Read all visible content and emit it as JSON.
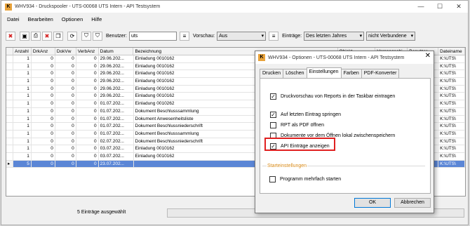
{
  "window": {
    "title": "WHV934 - Druckspooler - UTS-00068 UTS Intern - API Testsystem",
    "logo": "K"
  },
  "menu": [
    "Datei",
    "Bearbeiten",
    "Optionen",
    "Hilfe"
  ],
  "toolbar": {
    "benutzer_label": "Benutzer:",
    "benutzer_value": "uts",
    "vorschau_label": "Vorschau:",
    "vorschau_value": "Aus",
    "eintraege_label": "Einträge:",
    "eintraege_value": "Des letzten Jahres",
    "verbunden_value": "nicht Verbundene"
  },
  "grid": {
    "columns": [
      "Anzahl",
      "DrkAnz",
      "DokVw",
      "VerbAnz",
      "Datum",
      "Bezeichnung",
      "Objekt",
      "Vorgangsobj.",
      "Benutzer",
      "Dateiname"
    ],
    "rows": [
      [
        "1",
        "0",
        "0",
        "0",
        "29.06.202...",
        "Einladung 0010162",
        "",
        "",
        "",
        "K:\\UTS\\"
      ],
      [
        "1",
        "0",
        "0",
        "0",
        "29.06.202...",
        "Einladung 0010162",
        "",
        "",
        "",
        "K:\\UTS\\"
      ],
      [
        "1",
        "0",
        "0",
        "0",
        "29.06.202...",
        "Einladung 0010162",
        "",
        "",
        "",
        "K:\\UTS\\"
      ],
      [
        "1",
        "0",
        "0",
        "0",
        "29.06.202...",
        "Einladung 0010162",
        "",
        "",
        "",
        "K:\\UTS\\"
      ],
      [
        "1",
        "0",
        "0",
        "0",
        "29.06.202...",
        "Einladung 0010162",
        "",
        "",
        "",
        "K:\\UTS\\"
      ],
      [
        "1",
        "0",
        "0",
        "0",
        "29.06.202...",
        "Einladung 0010162",
        "",
        "",
        "",
        "K:\\UTS\\"
      ],
      [
        "1",
        "0",
        "0",
        "0",
        "01.07.202...",
        "Einladung 0010262",
        "",
        "",
        "",
        "K:\\UTS\\"
      ],
      [
        "1",
        "0",
        "0",
        "0",
        "01.07.202...",
        "Dokument Beschlusssammlung",
        "",
        "",
        "",
        "K:\\UTS\\"
      ],
      [
        "1",
        "0",
        "0",
        "0",
        "01.07.202...",
        "Dokument Anwesenheitsliste",
        "",
        "",
        "",
        "K:\\UTS\\"
      ],
      [
        "1",
        "0",
        "0",
        "0",
        "01.07.202...",
        "Dokument Beschlussniederschrift",
        "",
        "",
        "",
        "K:\\UTS\\"
      ],
      [
        "1",
        "0",
        "0",
        "0",
        "01.07.202...",
        "Dokument Beschlusssammlung",
        "",
        "",
        "",
        "K:\\UTS\\"
      ],
      [
        "1",
        "0",
        "0",
        "0",
        "02.07.202...",
        "Dokument Beschlussniederschrift",
        "",
        "",
        "",
        "K:\\UTS\\"
      ],
      [
        "1",
        "0",
        "0",
        "0",
        "03.07.202...",
        "Einladung 0010162",
        "",
        "",
        "",
        "K:\\UTS\\"
      ],
      [
        "1",
        "0",
        "0",
        "0",
        "03.07.202...",
        "Einladung 0010162",
        "",
        "",
        "",
        "K:\\UTS\\"
      ],
      [
        "5",
        "0",
        "0",
        "0",
        "23.07.202...",
        "",
        "",
        "",
        "",
        "K:\\UTS\\"
      ]
    ]
  },
  "status": {
    "text": "5 Einträge ausgewählt"
  },
  "dialog": {
    "title": "WHV934 - Optionen - UTS-00068 UTS Intern - API Testsystem",
    "tabs": [
      "Drucken",
      "Löschen",
      "Einstellungen",
      "Farben",
      "PDF-Konverter"
    ],
    "active_tab": "Einstellungen",
    "options": [
      {
        "label": "Druckvorschau von Reports in der Taskbar eintragen",
        "checked": true
      },
      {
        "label": "Auf letzten Eintrag springen",
        "checked": true
      },
      {
        "label": "RPT als PDF öffnen",
        "checked": false
      },
      {
        "label": "Dokumente vor dem Öffnen lokal zwischenspeichern",
        "checked": false
      },
      {
        "label": "API Einträge anzeigen",
        "checked": true
      }
    ],
    "group_label": "Starteinstellungen",
    "group_option": {
      "label": "Programm mehrfach starten",
      "checked": false
    },
    "ok_label": "OK",
    "cancel_label": "Abbrechen",
    "highlight_color": "#e02020"
  }
}
